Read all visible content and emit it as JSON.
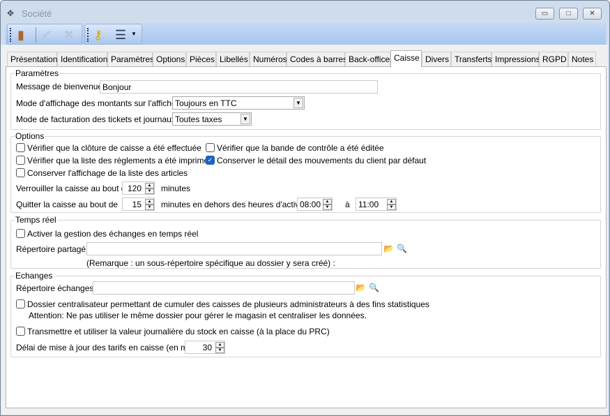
{
  "window": {
    "title": "Société",
    "minimize": "▭",
    "maximize": "□",
    "close": "✕"
  },
  "toolbar": {
    "icons": [
      "exit-door-icon",
      "validate-check-icon",
      "cancel-icon",
      "key-icon",
      "report-icon"
    ]
  },
  "tabs": [
    {
      "label": "Présentation"
    },
    {
      "label": "Identification"
    },
    {
      "label": "Paramètres"
    },
    {
      "label": "Options"
    },
    {
      "label": "Pièces"
    },
    {
      "label": "Libellés"
    },
    {
      "label": "Numéros"
    },
    {
      "label": "Codes à barres"
    },
    {
      "label": "Back-office"
    },
    {
      "label": "Caisse",
      "selected": true
    },
    {
      "label": "Divers"
    },
    {
      "label": "Transferts"
    },
    {
      "label": "Impressions"
    },
    {
      "label": "RGPD"
    },
    {
      "label": "Notes"
    }
  ],
  "parametres": {
    "title": "Paramètres",
    "welcome_label": "Message de bienvenue :",
    "welcome_value": "Bonjour",
    "display_label": "Mode d'affichage des montants sur l'afficheur :",
    "display_value": "Toujours en TTC",
    "billing_label": "Mode de facturation des tickets et journaux :",
    "billing_value": "Toutes taxes"
  },
  "options": {
    "title": "Options",
    "checks": [
      {
        "label": "Vérifier que la clôture de caisse a été effectuée",
        "checked": false
      },
      {
        "label": "Vérifier que la liste des règlements a été imprimée",
        "checked": false
      },
      {
        "label": "Conserver l'affichage de la liste des articles",
        "checked": false
      },
      {
        "label": "Vérifier que la bande de contrôle a été éditée",
        "checked": false
      },
      {
        "label": "Conserver le détail des mouvements du client par défaut",
        "checked": true
      }
    ],
    "lock_label": "Verrouiller la caisse au bout de",
    "lock_value": "120",
    "lock_unit": "minutes",
    "quit_label": "Quitter la caisse au bout de",
    "quit_value": "15",
    "quit_unit": "minutes  en dehors des heures d'activité",
    "from_value": "08:00",
    "to_label": "à",
    "to_value": "11:00"
  },
  "realtime": {
    "title": "Temps réel",
    "check_label": "Activer la gestion des échanges en temps réel",
    "checked": false,
    "dir_label": "Répertoire partagé :",
    "dir_value": "",
    "remark": "(Remarque : un sous-répertoire spécifique au dossier y sera créé) :"
  },
  "echanges": {
    "title": "Echanges",
    "dir_label": "Répertoire échanges :",
    "dir_value": "",
    "central_label": "Dossier centralisateur permettant de cumuler des caisses de plusieurs administrateurs à des fins statistiques",
    "central_checked": false,
    "attention": "Attention: Ne pas utiliser le même dossier pour gérer le magasin et centraliser les données.",
    "stock_label": "Transmettre et utiliser la valeur journalière du stock en caisse (à la place du PRC)",
    "stock_checked": false,
    "delay_label": "Délai de mise à jour des tarifs en caisse (en mn):",
    "delay_value": "30"
  }
}
